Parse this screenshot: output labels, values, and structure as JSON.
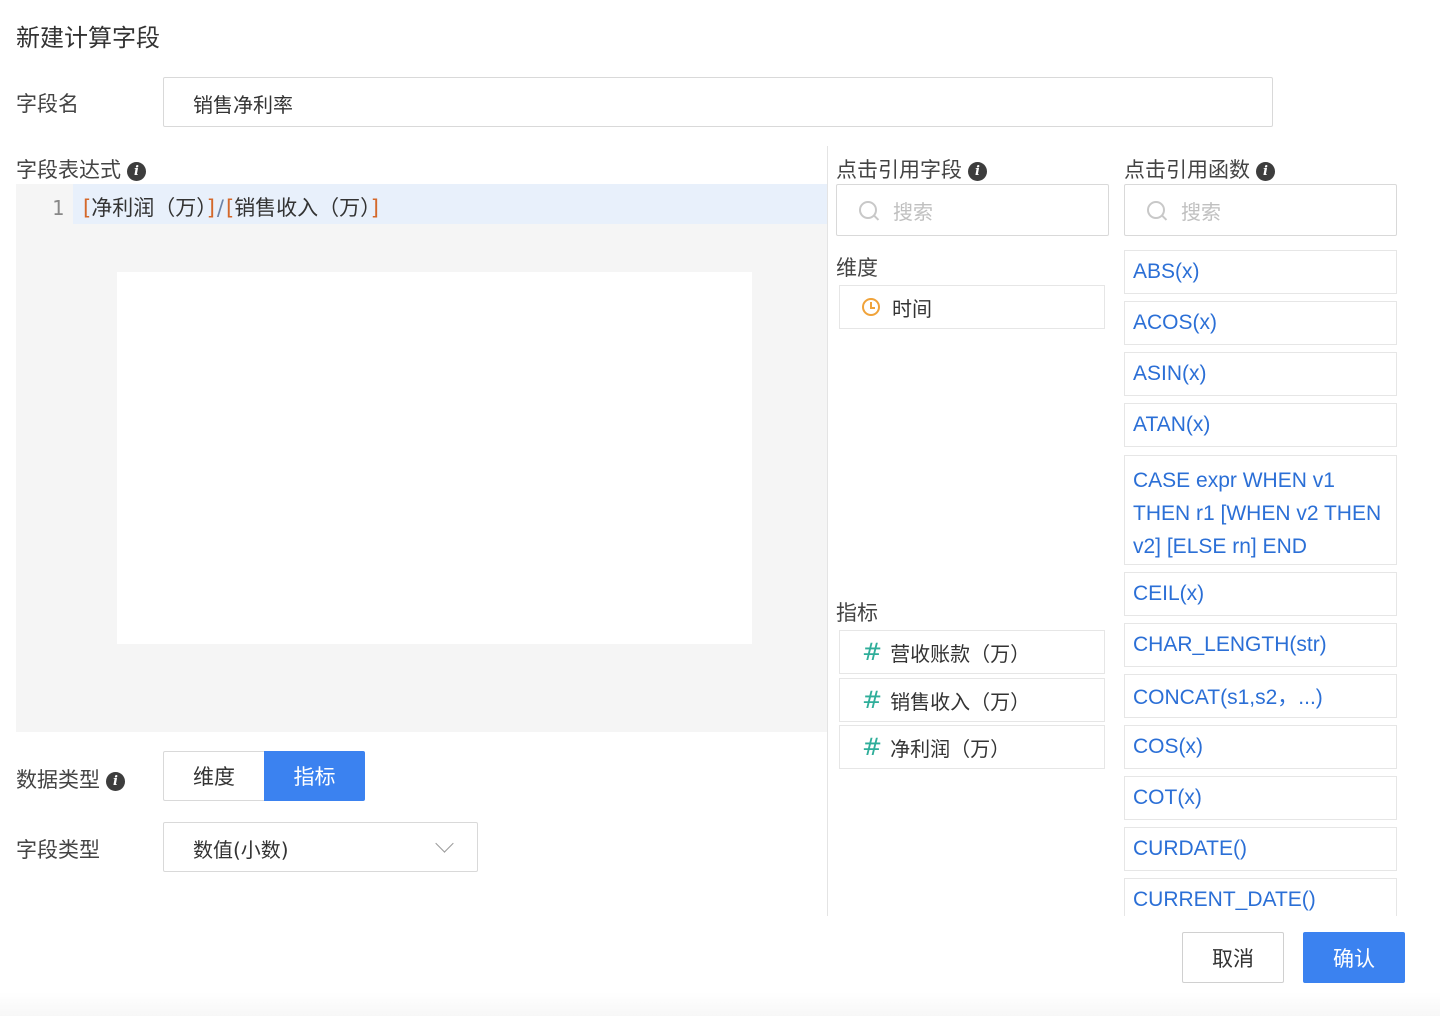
{
  "dialog": {
    "title": "新建计算字段"
  },
  "field_name": {
    "label": "字段名",
    "value": "销售净利率"
  },
  "expression": {
    "label": "字段表达式",
    "line_number": "1",
    "tokens": {
      "open1": "[",
      "field1": "净利润（万）",
      "close1": "]",
      "operator": "/",
      "open2": "[",
      "field2": "销售收入（万）",
      "close2": "]"
    }
  },
  "data_type": {
    "label": "数据类型",
    "options": [
      "维度",
      "指标"
    ],
    "selected": "指标"
  },
  "field_type": {
    "label": "字段类型",
    "value": "数值(小数)"
  },
  "fields_panel": {
    "label": "点击引用字段",
    "search_placeholder": "搜索",
    "dimension_heading": "维度",
    "dimensions": [
      {
        "name": "时间",
        "icon": "clock-icon"
      }
    ],
    "metric_heading": "指标",
    "metrics": [
      {
        "name": "营收账款（万）",
        "icon": "hash-icon",
        "glyph": "#"
      },
      {
        "name": "销售收入（万）",
        "icon": "hash-icon",
        "glyph": "#"
      },
      {
        "name": "净利润（万）",
        "icon": "hash-icon",
        "glyph": "#"
      }
    ]
  },
  "functions_panel": {
    "label": "点击引用函数",
    "search_placeholder": "搜索",
    "functions": [
      "ABS(x)",
      "ACOS(x)",
      "ASIN(x)",
      "ATAN(x)",
      "CASE expr WHEN v1 THEN r1 [WHEN v2 THEN v2] [ELSE rn] END",
      "CEIL(x)",
      "CHAR_LENGTH(str)",
      "CONCAT(s1,s2，...)",
      "COS(x)",
      "COT(x)",
      "CURDATE()",
      "CURRENT_DATE()"
    ]
  },
  "footer": {
    "cancel_label": "取消",
    "confirm_label": "确认"
  },
  "colors": {
    "accent": "#3b82f0",
    "function_text": "#2b6fd6",
    "bracket": "#d4682b",
    "hash_icon": "#2fae9a",
    "clock_icon": "#f0a33a"
  }
}
